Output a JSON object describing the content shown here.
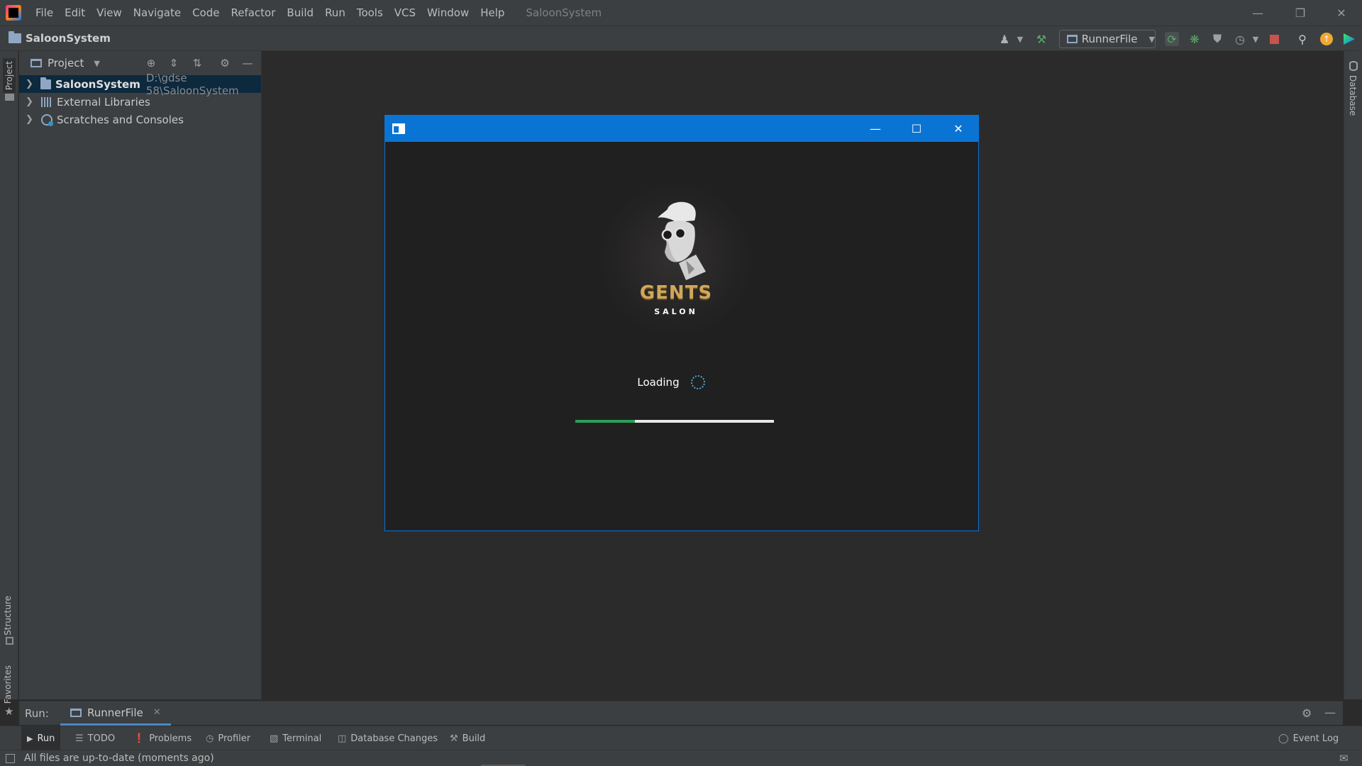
{
  "menubar": {
    "items": [
      "File",
      "Edit",
      "View",
      "Navigate",
      "Code",
      "Refactor",
      "Build",
      "Run",
      "Tools",
      "VCS",
      "Window",
      "Help"
    ],
    "window_title": "SaloonSystem"
  },
  "navbar": {
    "project_name": "SaloonSystem",
    "run_config": "RunnerFile"
  },
  "project_panel": {
    "title": "Project",
    "tree": [
      {
        "label": "SaloonSystem",
        "path": "D:\\gdse 58\\SaloonSystem"
      },
      {
        "label": "External Libraries"
      },
      {
        "label": "Scratches and Consoles"
      }
    ]
  },
  "side_tabs": {
    "left_top": "Project",
    "left_structure": "Structure",
    "left_favorites": "Favorites",
    "right": "Database"
  },
  "splash": {
    "brand_name": "GENTS",
    "brand_sub": "SALON",
    "loading_text": "Loading",
    "progress": 0.3
  },
  "run_bar": {
    "label": "Run:",
    "tab": "RunnerFile"
  },
  "bottom_tabs": [
    "Run",
    "TODO",
    "Problems",
    "Profiler",
    "Terminal",
    "Database Changes",
    "Build"
  ],
  "event_log": "Event Log",
  "status": {
    "text": "All files are up-to-date (moments ago)"
  },
  "colors": {
    "accent": "#0a74d4",
    "progress": "#2aa15a",
    "brand_gold": "#d1a75a",
    "ide_bg": "#2b2b2b",
    "panel_bg": "#3c3f41"
  }
}
